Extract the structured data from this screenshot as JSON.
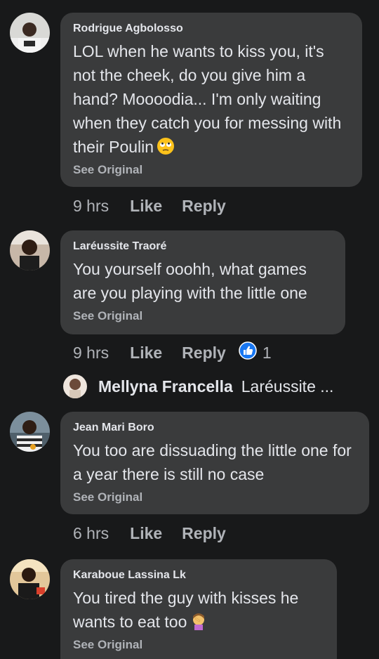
{
  "comments": [
    {
      "author": "Rodrigue Agbolosso",
      "text": "LOL when he wants to kiss you, it's not the cheek, do you give him a hand? Moooodia... I'm only waiting when they catch you for messing with their Poulin",
      "emoji": "face-with-rolling-eyes-emoji",
      "see_original": "See Original",
      "time": "9 hrs",
      "like": "Like",
      "reply": "Reply"
    },
    {
      "author": "Laréussite Traoré",
      "text": "You yourself ooohh, what games are you playing with the little one",
      "see_original": "See Original",
      "time": "9 hrs",
      "like": "Like",
      "reply": "Reply",
      "reaction_icon": "like-reaction-icon",
      "reaction_count": "1"
    },
    {
      "author": "Jean Mari Boro",
      "text": "You too are dissuading the little one for a year there is still no case",
      "see_original": "See Original",
      "time": "6 hrs",
      "like": "Like",
      "reply": "Reply"
    },
    {
      "author": "Karaboue Lassina Lk",
      "text": "You tired the guy with kisses he wants to eat too",
      "emoji": "woman-facepalming-emoji",
      "see_original": "See Original"
    }
  ],
  "reply_preview": {
    "author": "Mellyna Francella",
    "snippet": "Laréussite ..."
  },
  "colors": {
    "background": "#18191a",
    "bubble": "#3a3b3c",
    "primary_text": "#e4e6eb",
    "secondary_text": "#b0b3b8",
    "like_blue": "#1877f2"
  }
}
